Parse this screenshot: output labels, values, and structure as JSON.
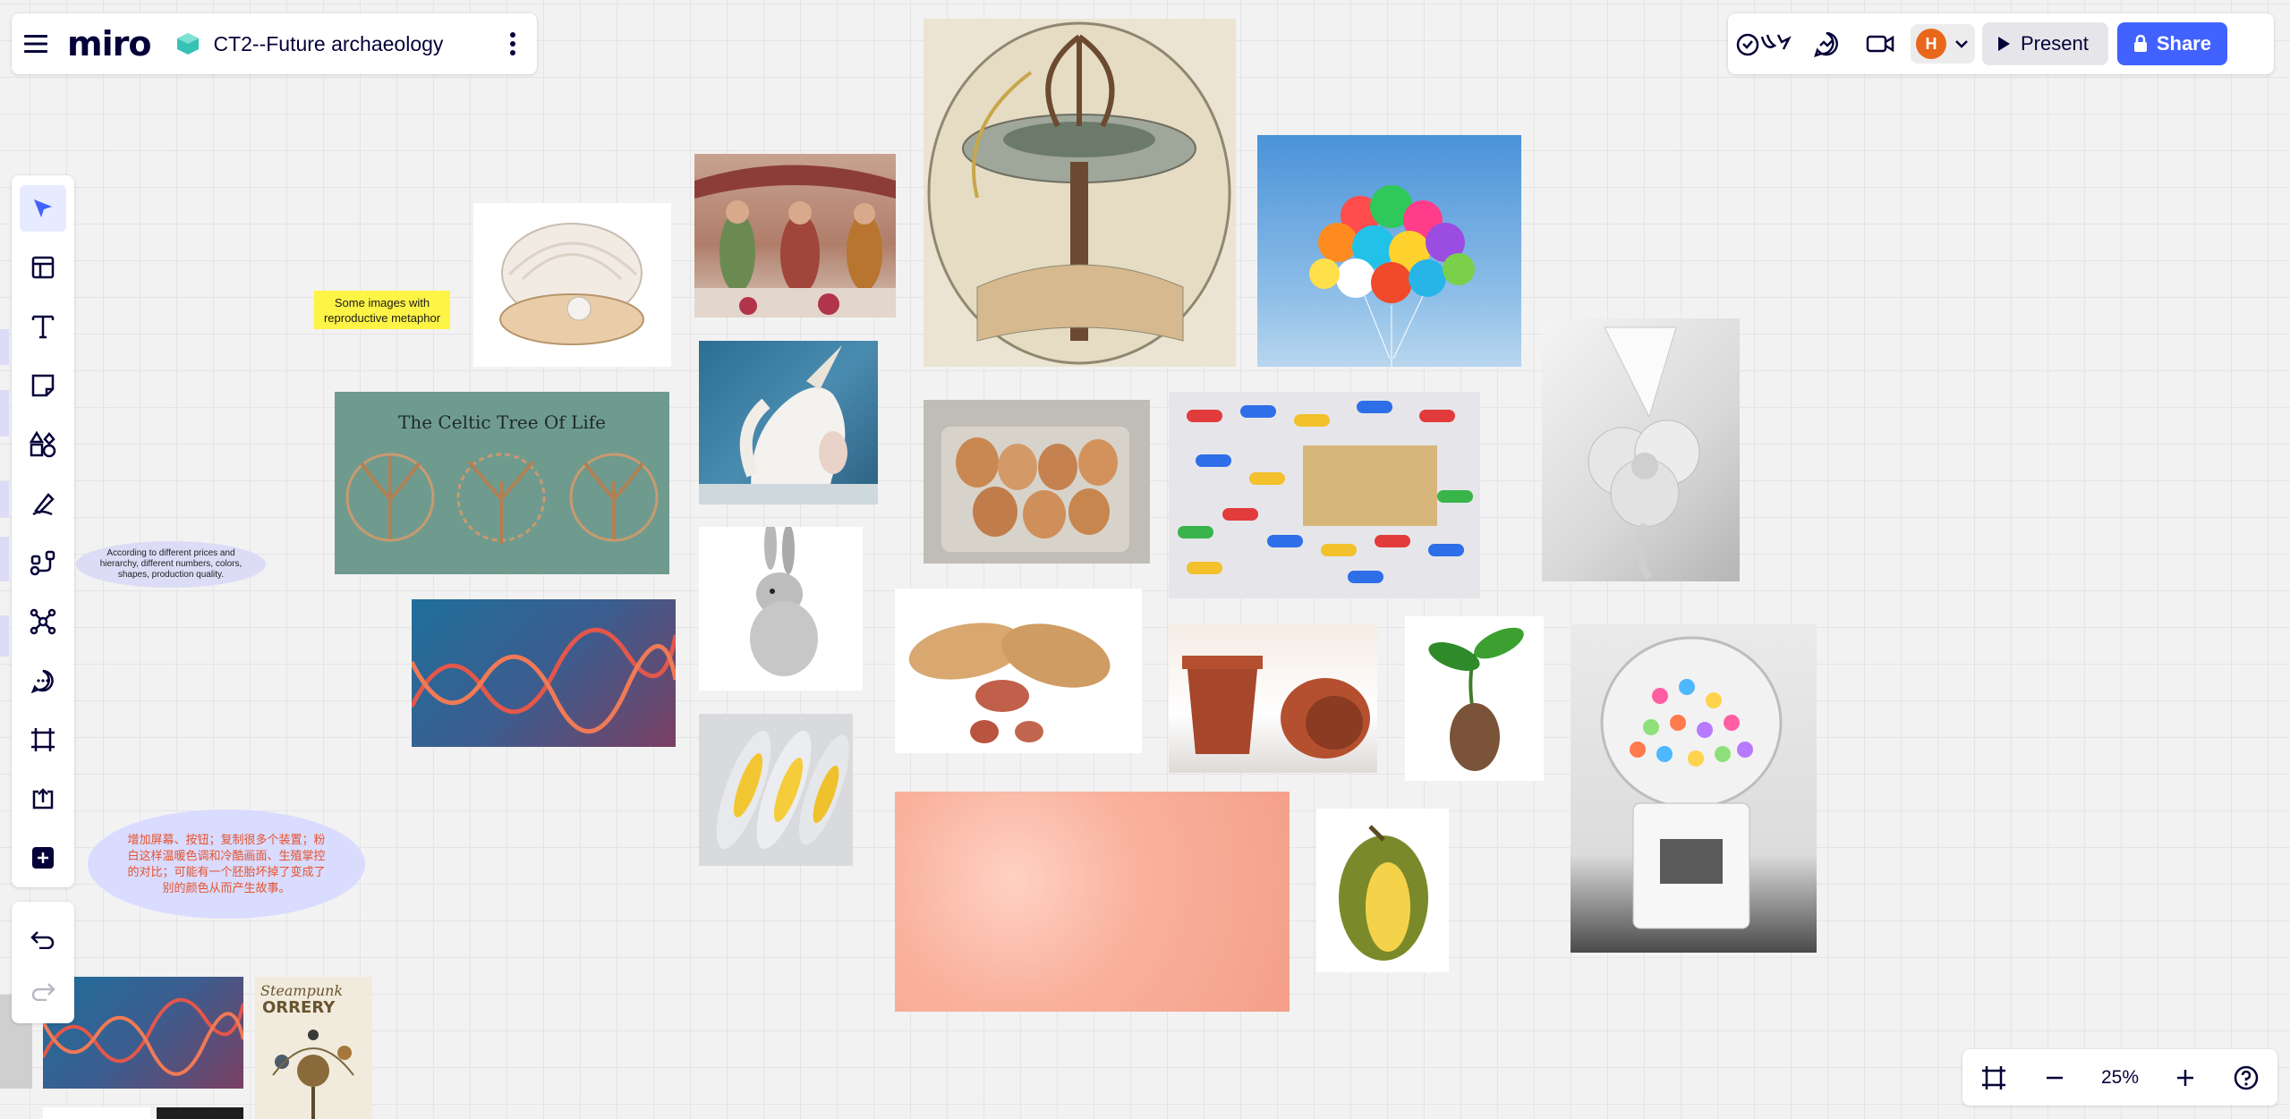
{
  "app": {
    "logo": "miro",
    "board_title": "CT2--Future archaeology"
  },
  "topbar": {
    "user_initial": "H",
    "present_label": "Present",
    "share_label": "Share"
  },
  "toolbar": {
    "tools": [
      "select-tool",
      "templates-tool",
      "text-tool",
      "sticky-note-tool",
      "shapes-tool",
      "pen-tool",
      "connection-line-tool",
      "mind-map-tool",
      "comment-tool",
      "frame-tool",
      "upload-tool",
      "more-apps-tool"
    ]
  },
  "canvas": {
    "sticky_note": "Some images with reproductive metaphor",
    "ellipse_note_1": "According to different prices and hierarchy, different numbers, colors, shapes, production quality.",
    "ellipse_note_2": "增加屏幕、按钮；复制很多个装置；粉白这样温暖色调和冷酷画面、生殖掌控的对比；可能有一个胚胎坏掉了变成了别的颜色从而产生故事。",
    "celtic_caption": "The Celtic Tree Of Life",
    "orrery_caption_1": "Steampunk",
    "orrery_caption_2": "ORRERY"
  },
  "zoom": {
    "value": "25%"
  },
  "colors": {
    "accent": "#4262ff",
    "avatar": "#e8671b",
    "sticky": "#fef445",
    "ellipse": "#d9dbff",
    "ellipse_text": "#e5532d"
  }
}
